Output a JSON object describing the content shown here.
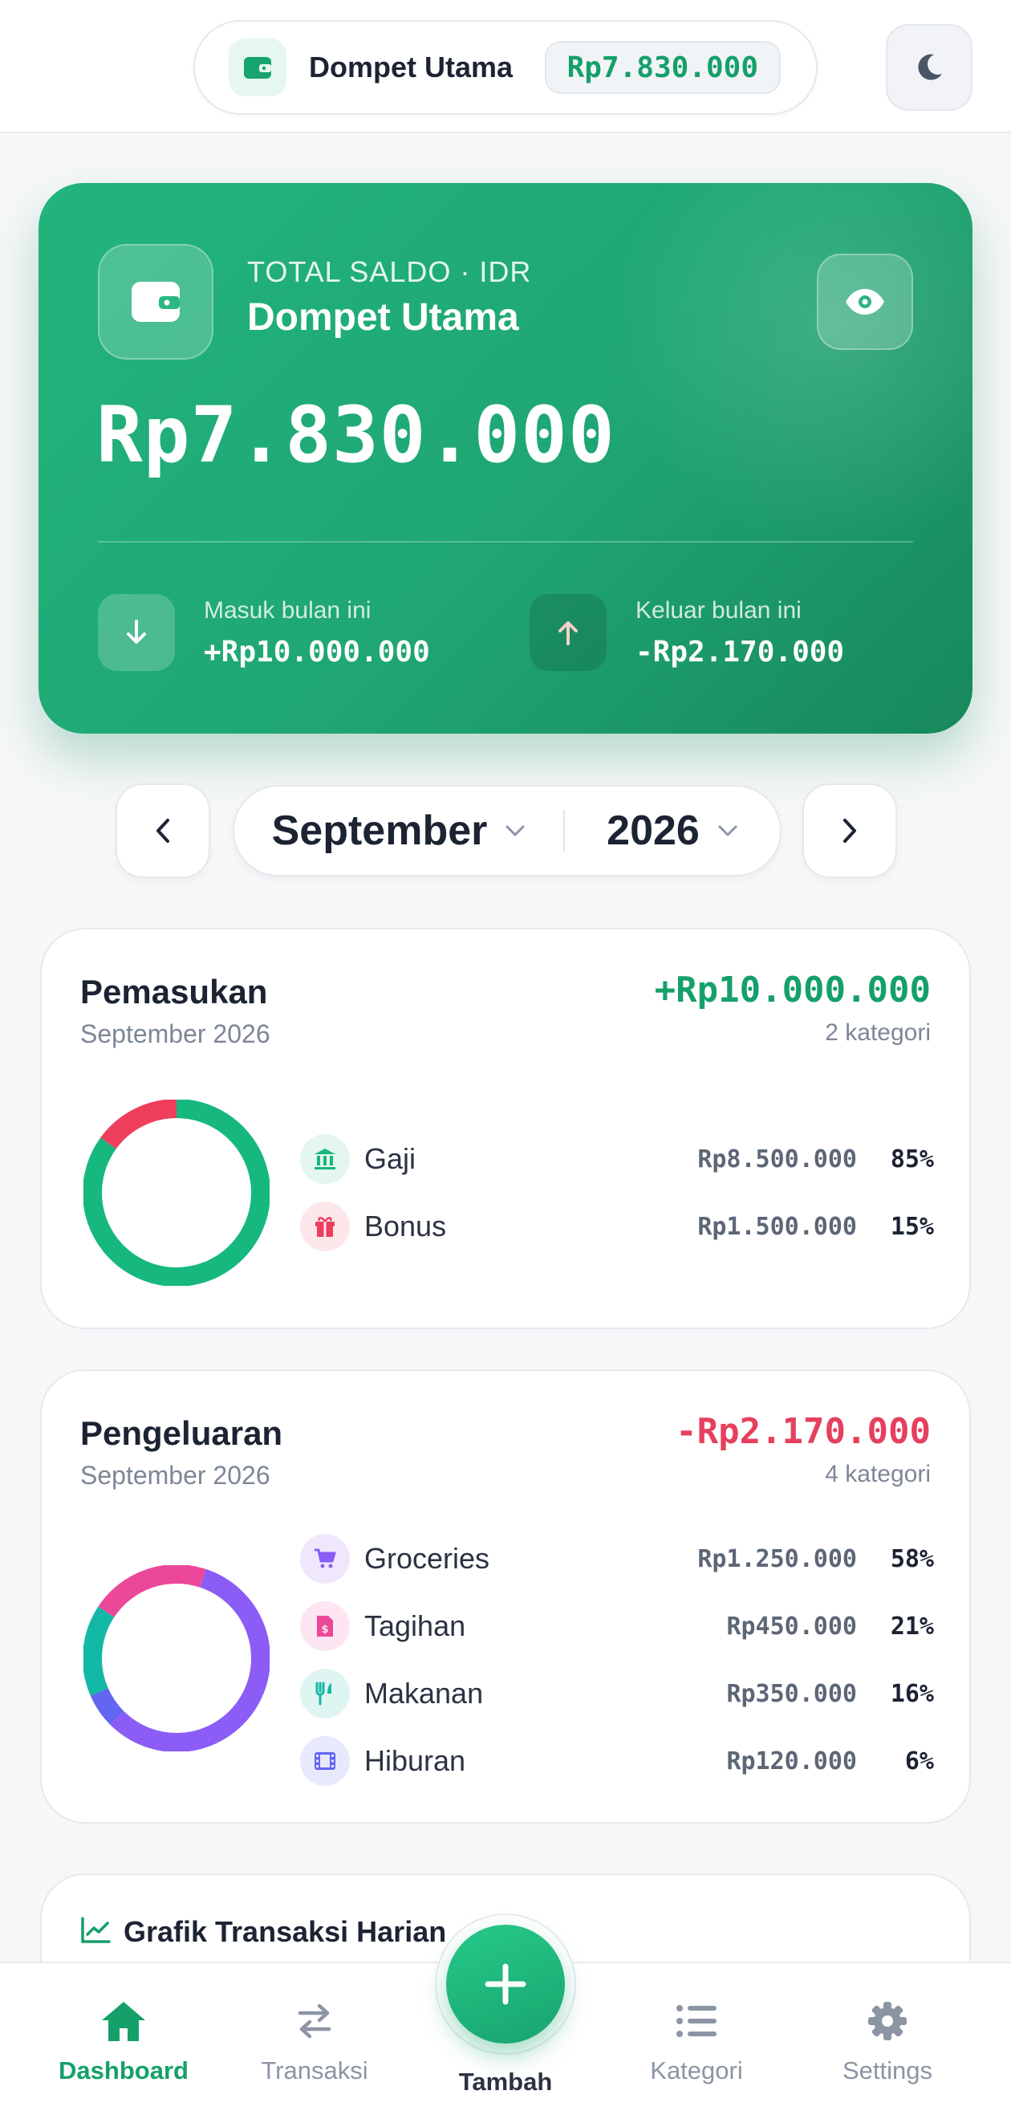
{
  "header": {
    "wallet_name": "Dompet Utama",
    "wallet_balance": "Rp7.830.000"
  },
  "balance_card": {
    "label": "TOTAL SALDO · IDR",
    "wallet_name": "Dompet Utama",
    "amount": "Rp7.830.000",
    "income_label": "Masuk bulan ini",
    "income_value": "+Rp10.000.000",
    "expense_label": "Keluar bulan ini",
    "expense_value": "-Rp2.170.000"
  },
  "period": {
    "month": "September",
    "year": "2026"
  },
  "income": {
    "title": "Pemasukan",
    "subtitle": "September 2026",
    "total": "+Rp10.000.000",
    "count": "2 kategori",
    "items": [
      {
        "name": "Gaji",
        "amount": "Rp8.500.000",
        "pct": "85%",
        "value": 85,
        "color": "#16b87e",
        "icon": "bank-icon"
      },
      {
        "name": "Bonus",
        "amount": "Rp1.500.000",
        "pct": "15%",
        "value": 15,
        "color": "#ef3e5c",
        "icon": "gift-icon"
      }
    ]
  },
  "expense": {
    "title": "Pengeluaran",
    "subtitle": "September 2026",
    "total": "-Rp2.170.000",
    "count": "4 kategori",
    "items": [
      {
        "name": "Groceries",
        "amount": "Rp1.250.000",
        "pct": "58%",
        "value": 58,
        "color": "#8b5cf6",
        "icon": "cart-icon"
      },
      {
        "name": "Tagihan",
        "amount": "Rp450.000",
        "pct": "21%",
        "value": 21,
        "color": "#ec4899",
        "icon": "bill-icon"
      },
      {
        "name": "Makanan",
        "amount": "Rp350.000",
        "pct": "16%",
        "value": 16,
        "color": "#14b8a6",
        "icon": "utensils-icon"
      },
      {
        "name": "Hiburan",
        "amount": "Rp120.000",
        "pct": "6%",
        "value": 6,
        "color": "#6366f1",
        "icon": "film-icon"
      }
    ]
  },
  "daily_chart": {
    "title": "Grafik Transaksi Harian"
  },
  "bottom_nav": {
    "dashboard": "Dashboard",
    "transaksi": "Transaksi",
    "tambah": "Tambah",
    "kategori": "Kategori",
    "settings": "Settings"
  },
  "colors": {
    "accent": "#15a06a",
    "income": "#15a06a",
    "expense": "#e5405e"
  }
}
